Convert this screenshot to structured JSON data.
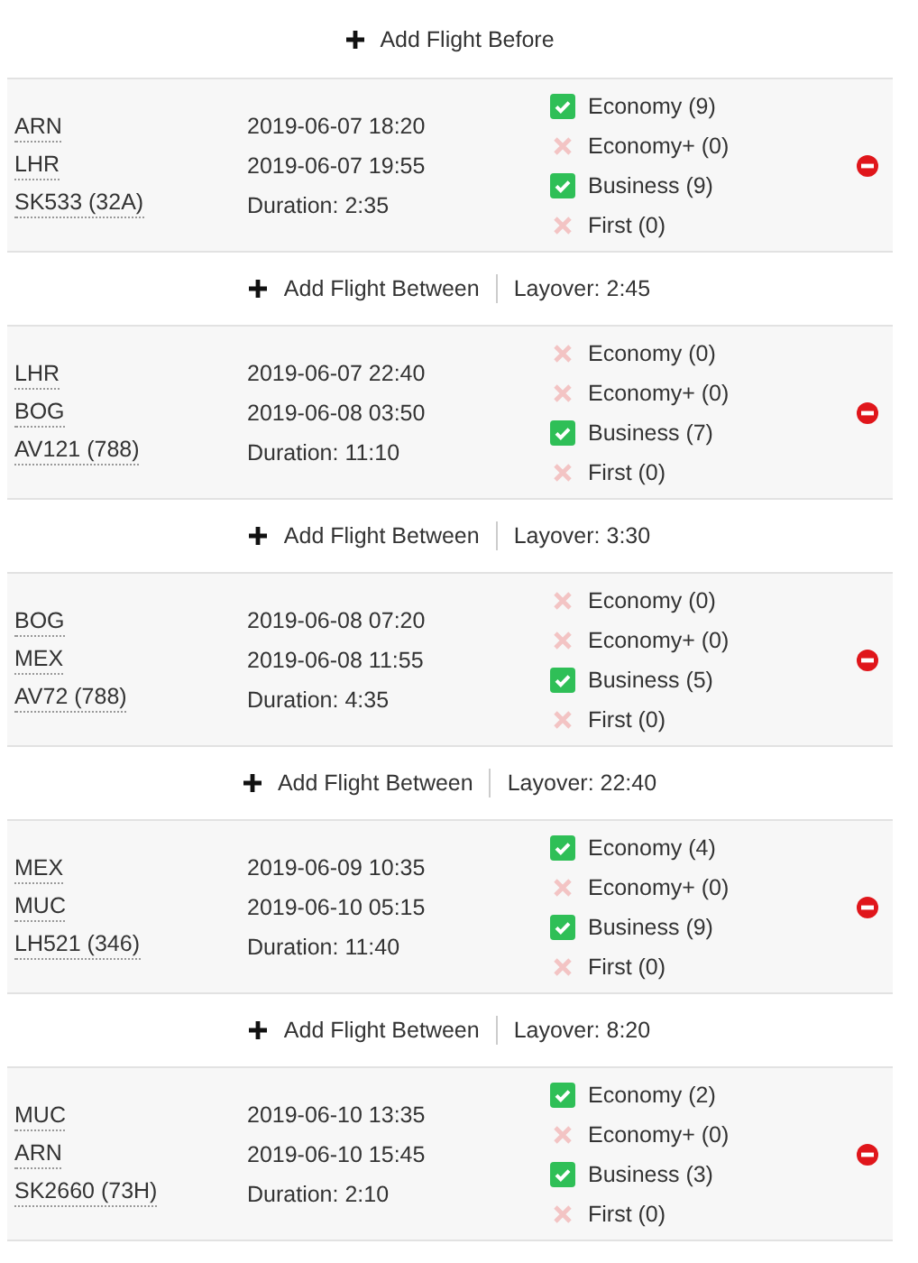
{
  "add_before": "Add Flight Before",
  "flights": [
    {
      "origin": "ARN",
      "destination": "LHR",
      "flight": "SK533 (32A)",
      "departure": "2019-06-07 18:20",
      "arrival": "2019-06-07 19:55",
      "duration": "Duration: 2:35",
      "classes": [
        {
          "label": "Economy (9)",
          "checked": true
        },
        {
          "label": "Economy+ (0)",
          "checked": false
        },
        {
          "label": "Business (9)",
          "checked": true
        },
        {
          "label": "First (0)",
          "checked": false
        }
      ],
      "between": {
        "label": "Add Flight Between",
        "layover": "Layover: 2:45"
      }
    },
    {
      "origin": "LHR",
      "destination": "BOG",
      "flight": "AV121 (788)",
      "departure": "2019-06-07 22:40",
      "arrival": "2019-06-08 03:50",
      "duration": "Duration: 11:10",
      "classes": [
        {
          "label": "Economy (0)",
          "checked": false
        },
        {
          "label": "Economy+ (0)",
          "checked": false
        },
        {
          "label": "Business (7)",
          "checked": true
        },
        {
          "label": "First (0)",
          "checked": false
        }
      ],
      "between": {
        "label": "Add Flight Between",
        "layover": "Layover: 3:30"
      }
    },
    {
      "origin": "BOG",
      "destination": "MEX",
      "flight": "AV72 (788)",
      "departure": "2019-06-08 07:20",
      "arrival": "2019-06-08 11:55",
      "duration": "Duration: 4:35",
      "classes": [
        {
          "label": "Economy (0)",
          "checked": false
        },
        {
          "label": "Economy+ (0)",
          "checked": false
        },
        {
          "label": "Business (5)",
          "checked": true
        },
        {
          "label": "First (0)",
          "checked": false
        }
      ],
      "between": {
        "label": "Add Flight Between",
        "layover": "Layover: 22:40"
      }
    },
    {
      "origin": "MEX",
      "destination": "MUC",
      "flight": "LH521 (346)",
      "departure": "2019-06-09 10:35",
      "arrival": "2019-06-10 05:15",
      "duration": "Duration: 11:40",
      "classes": [
        {
          "label": "Economy (4)",
          "checked": true
        },
        {
          "label": "Economy+ (0)",
          "checked": false
        },
        {
          "label": "Business (9)",
          "checked": true
        },
        {
          "label": "First (0)",
          "checked": false
        }
      ],
      "between": {
        "label": "Add Flight Between",
        "layover": "Layover: 8:20"
      }
    },
    {
      "origin": "MUC",
      "destination": "ARN",
      "flight": "SK2660 (73H)",
      "departure": "2019-06-10 13:35",
      "arrival": "2019-06-10 15:45",
      "duration": "Duration: 2:10",
      "classes": [
        {
          "label": "Economy (2)",
          "checked": true
        },
        {
          "label": "Economy+ (0)",
          "checked": false
        },
        {
          "label": "Business (3)",
          "checked": true
        },
        {
          "label": "First (0)",
          "checked": false
        }
      ]
    }
  ]
}
